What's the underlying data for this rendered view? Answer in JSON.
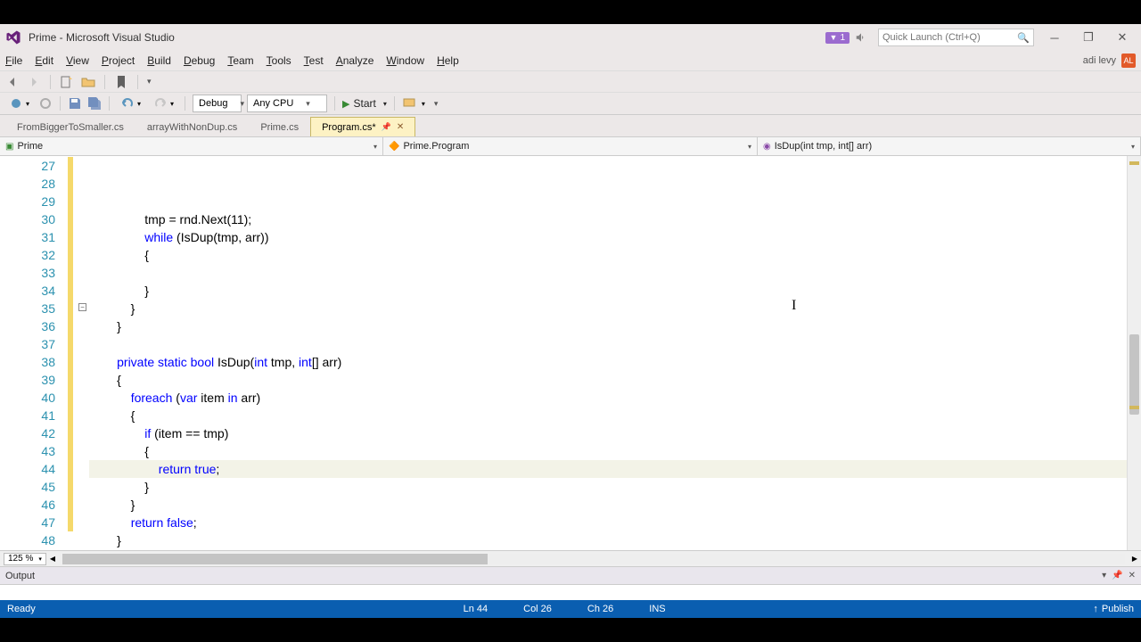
{
  "title": "Prime - Microsoft Visual Studio",
  "notifications": "1",
  "search_placeholder": "Quick Launch (Ctrl+Q)",
  "user": {
    "name": "adi levy",
    "initials": "AL"
  },
  "menus": [
    "File",
    "Edit",
    "View",
    "Project",
    "Build",
    "Debug",
    "Team",
    "Tools",
    "Test",
    "Analyze",
    "Window",
    "Help"
  ],
  "config": {
    "solution": "Debug",
    "platform": "Any CPU",
    "start": "Start"
  },
  "tabs": [
    {
      "label": "FromBiggerToSmaller.cs",
      "active": false
    },
    {
      "label": "arrayWithNonDup.cs",
      "active": false
    },
    {
      "label": "Prime.cs",
      "active": false
    },
    {
      "label": "Program.cs*",
      "active": true
    }
  ],
  "nav": {
    "project": "Prime",
    "class": "Prime.Program",
    "member": "IsDup(int tmp, int[] arr)"
  },
  "zoom": "125 %",
  "output_title": "Output",
  "status": {
    "ready": "Ready",
    "ln": "Ln 44",
    "col": "Col 26",
    "ch": "Ch 26",
    "ins": "INS",
    "publish": "Publish"
  },
  "first_line": 27,
  "current_line": 44,
  "code": [
    {
      "indent": 16,
      "tokens": [
        [
          "",
          "tmp = rnd.Next(11);"
        ]
      ]
    },
    {
      "indent": 16,
      "tokens": [
        [
          "kw",
          "while"
        ],
        [
          "",
          " (IsDup(tmp, arr))"
        ]
      ]
    },
    {
      "indent": 16,
      "tokens": [
        [
          "",
          "{"
        ]
      ]
    },
    {
      "indent": 16,
      "tokens": [
        [
          "",
          ""
        ]
      ]
    },
    {
      "indent": 16,
      "tokens": [
        [
          "",
          "}"
        ]
      ]
    },
    {
      "indent": 12,
      "tokens": [
        [
          "",
          "}"
        ]
      ]
    },
    {
      "indent": 8,
      "tokens": [
        [
          "",
          "}"
        ]
      ]
    },
    {
      "indent": 0,
      "tokens": [
        [
          "",
          ""
        ]
      ]
    },
    {
      "indent": 8,
      "tokens": [
        [
          "kw",
          "private"
        ],
        [
          "",
          " "
        ],
        [
          "kw",
          "static"
        ],
        [
          "",
          " "
        ],
        [
          "kw",
          "bool"
        ],
        [
          "",
          " IsDup("
        ],
        [
          "kw",
          "int"
        ],
        [
          "",
          " tmp, "
        ],
        [
          "kw",
          "int"
        ],
        [
          "",
          "[] arr)"
        ]
      ]
    },
    {
      "indent": 8,
      "tokens": [
        [
          "",
          "{"
        ]
      ]
    },
    {
      "indent": 12,
      "tokens": [
        [
          "kw",
          "foreach"
        ],
        [
          "",
          " ("
        ],
        [
          "kw",
          "var"
        ],
        [
          "",
          " item "
        ],
        [
          "kw",
          "in"
        ],
        [
          "",
          " arr)"
        ]
      ]
    },
    {
      "indent": 12,
      "tokens": [
        [
          "",
          "{"
        ]
      ]
    },
    {
      "indent": 16,
      "tokens": [
        [
          "kw",
          "if"
        ],
        [
          "",
          " (item == tmp)"
        ]
      ]
    },
    {
      "indent": 16,
      "tokens": [
        [
          "",
          "{"
        ]
      ]
    },
    {
      "indent": 20,
      "tokens": [
        [
          "kw",
          "return"
        ],
        [
          "",
          " "
        ],
        [
          "kw",
          "true"
        ],
        [
          "",
          ";"
        ]
      ]
    },
    {
      "indent": 16,
      "tokens": [
        [
          "",
          "}"
        ]
      ]
    },
    {
      "indent": 12,
      "tokens": [
        [
          "",
          "}"
        ]
      ]
    },
    {
      "indent": 12,
      "tokens": [
        [
          "kw",
          "return"
        ],
        [
          "",
          " "
        ],
        [
          "kw",
          "false"
        ],
        [
          "",
          ";"
        ]
      ]
    },
    {
      "indent": 8,
      "tokens": [
        [
          "",
          "}"
        ]
      ]
    },
    {
      "indent": 4,
      "tokens": [
        [
          "",
          "}"
        ]
      ]
    },
    {
      "indent": 0,
      "tokens": [
        [
          "",
          "}"
        ]
      ]
    },
    {
      "indent": 0,
      "tokens": [
        [
          "",
          ""
        ]
      ]
    },
    {
      "indent": 0,
      "tokens": [
        [
          "",
          ""
        ]
      ]
    }
  ],
  "change_bars": [
    [
      0,
      7
    ],
    [
      8,
      20
    ]
  ]
}
